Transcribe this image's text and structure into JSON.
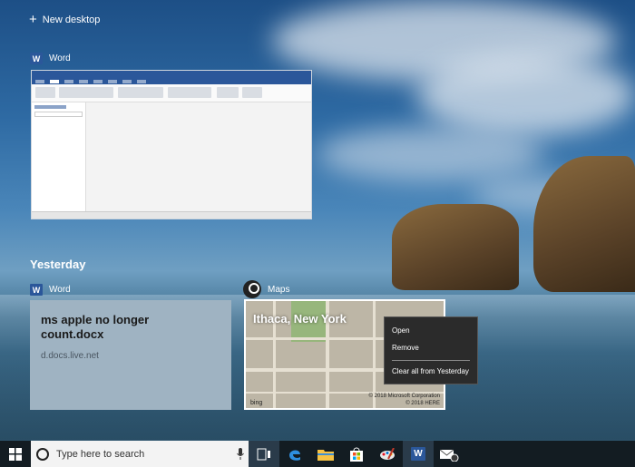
{
  "new_desktop": {
    "label": "New desktop"
  },
  "timeline": {
    "current": {
      "app_name": "Word"
    },
    "section_heading": "Yesterday",
    "cards": [
      {
        "app_name": "Word",
        "title": "ms apple no longer count.docx",
        "source": "d.docs.live.net"
      },
      {
        "app_name": "Maps",
        "title": "Ithaca, New York",
        "bing": "bing",
        "copyright_1": "© 2018 Microsoft Corporation",
        "copyright_2": "© 2018 HERE"
      }
    ]
  },
  "context_menu": {
    "items": [
      "Open",
      "Remove",
      "Clear all from Yesterday"
    ]
  },
  "taskbar": {
    "search_placeholder": "Type here to search",
    "icons": [
      "windows-start-icon",
      "task-view-icon",
      "edge-icon",
      "file-explorer-icon",
      "store-icon",
      "paint-icon",
      "word-icon",
      "mail-icon"
    ]
  },
  "colors": {
    "word_blue": "#2b579a",
    "taskbar": "#131c22",
    "menu_bg": "#2b2b2b"
  }
}
